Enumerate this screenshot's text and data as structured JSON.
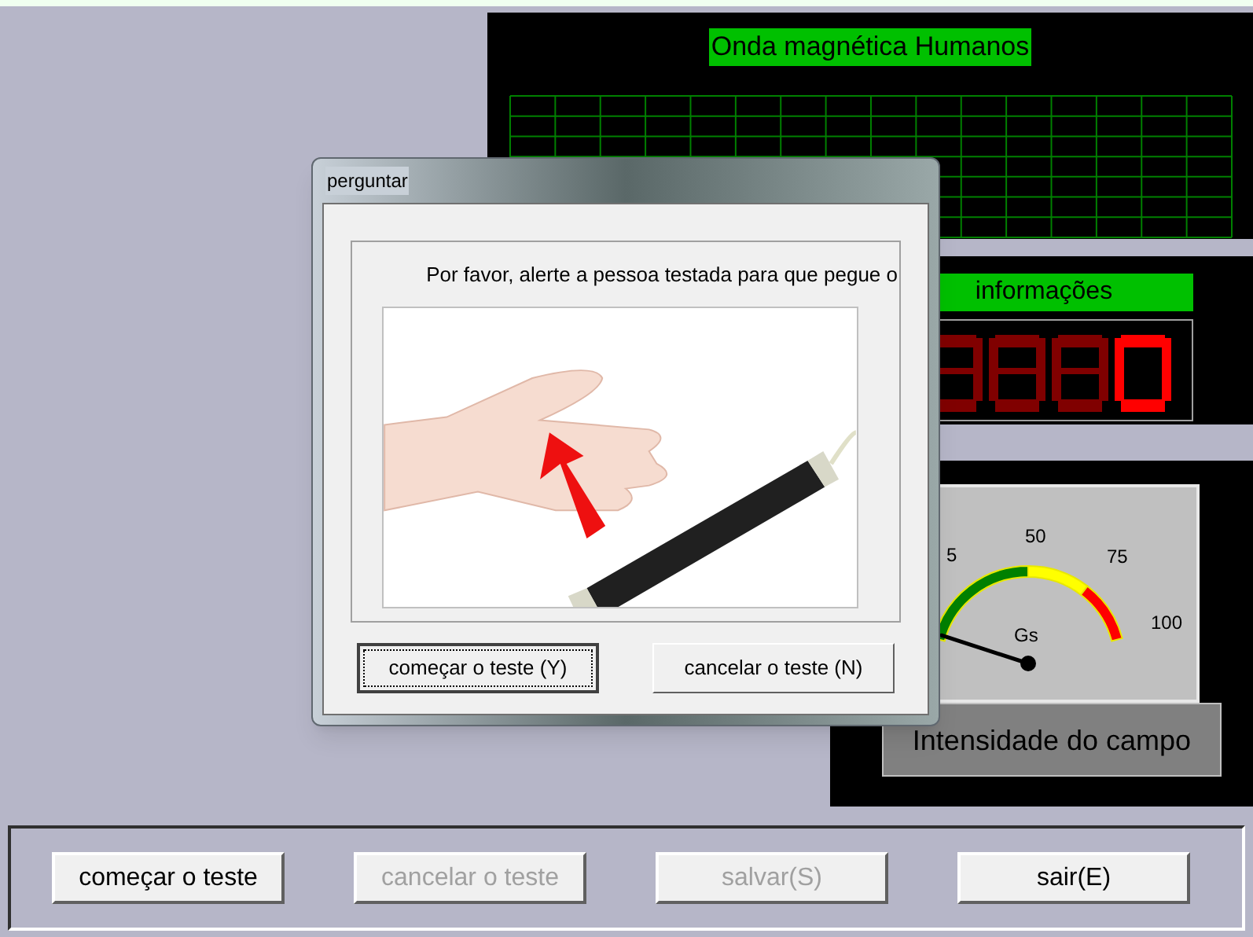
{
  "graph_panel": {
    "title": "Onda magnética Humanos"
  },
  "info_panel": {
    "title": "informações"
  },
  "gauge_panel": {
    "scale_labels": [
      "5",
      "50",
      "75",
      "100"
    ],
    "unit": "Gs",
    "level": 0.02,
    "caption": "Intensidade do campo"
  },
  "dialog": {
    "title": "perguntar",
    "message": "Por favor, alerte a pessoa testada para que pegue o",
    "buttons": [
      {
        "label": "começar o teste (Y)",
        "focused": true
      },
      {
        "label": "cancelar o teste (N)",
        "focused": false
      }
    ]
  },
  "toolbar": {
    "buttons": [
      {
        "label": "começar o teste",
        "disabled": false
      },
      {
        "label": "cancelar o teste",
        "disabled": true
      },
      {
        "label": "salvar(S)",
        "disabled": true
      },
      {
        "label": "sair(E)",
        "disabled": false
      }
    ]
  }
}
